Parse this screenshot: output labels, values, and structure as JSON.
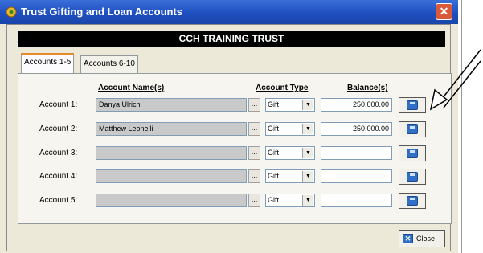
{
  "window": {
    "title": "Trust Gifting and Loan Accounts"
  },
  "trust_name": "CCH TRAINING TRUST",
  "tabs": [
    {
      "label": "Accounts 1-5",
      "active": true
    },
    {
      "label": "Accounts 6-10",
      "active": false
    }
  ],
  "headers": {
    "name": "Account Name(s)",
    "type": "Account Type",
    "balance": "Balance(s)"
  },
  "accounts": [
    {
      "label": "Account 1:",
      "name": "Danya Ulrich",
      "type": "Gift",
      "balance": "250,000.00"
    },
    {
      "label": "Account 2:",
      "name": "Matthew Leonelli",
      "type": "Gift",
      "balance": "250,000.00"
    },
    {
      "label": "Account 3:",
      "name": "",
      "type": "Gift",
      "balance": ""
    },
    {
      "label": "Account 4:",
      "name": "",
      "type": "Gift",
      "balance": ""
    },
    {
      "label": "Account 5:",
      "name": "",
      "type": "Gift",
      "balance": ""
    }
  ],
  "browse_label": "...",
  "close_button": {
    "label": "Close"
  },
  "icons": {
    "row_action": "save-disk-icon",
    "close": "close-icon",
    "app": "app-icon",
    "annotation": "arrow-pointer-icon"
  },
  "colors": {
    "titlebar": "#2457c5",
    "trust_bar": "#000000",
    "tab_accent": "#e68b2c"
  }
}
